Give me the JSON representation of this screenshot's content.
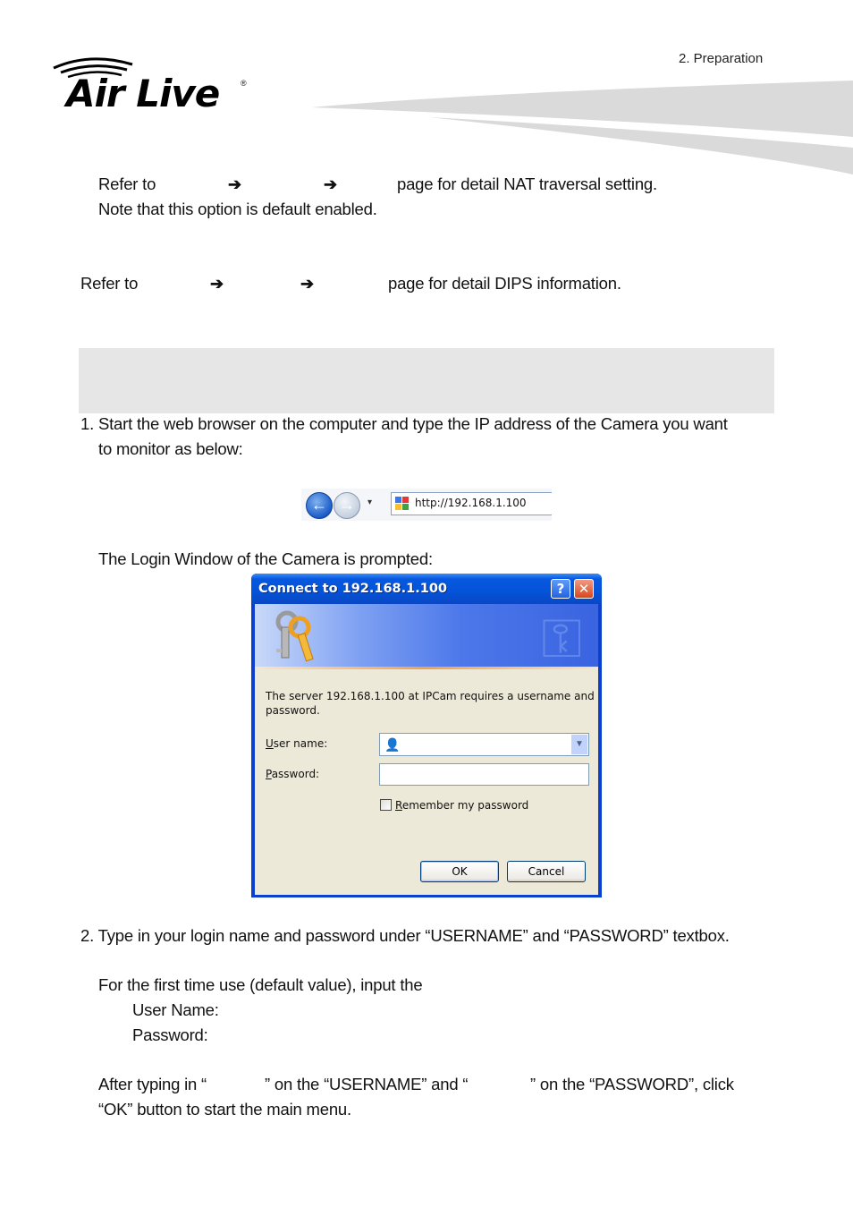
{
  "header": {
    "chapter": "2.  Preparation",
    "logo": {
      "brand": "Air Live",
      "registered": "®"
    }
  },
  "nat_section": {
    "line1_refer": "Refer to",
    "line1_arrow": "➔",
    "line1_tail": "page for detail NAT traversal setting.",
    "line2": "Note that this option is default enabled."
  },
  "dips_section": {
    "refer": "Refer to",
    "arrow": "➔",
    "tail": "page for detail DIPS information."
  },
  "steps": {
    "step1_line1": "1. Start the web browser on the computer and type the IP address of the Camera you want",
    "step1_line2": "to monitor as below:",
    "browser": {
      "back_icon": "back-arrow-icon",
      "forward_icon": "forward-arrow-icon",
      "dropdown_icon": "▾",
      "url": "http://192.168.1.100"
    },
    "login_prompt": "The Login Window of the Camera is prompted:",
    "step2": "2. Type in your login name and password under “USERNAME” and “PASSWORD” textbox.",
    "first_time": "For the first time use (default value), input the",
    "user_name_label": "User Name:",
    "password_label": "Password:",
    "after_typing_1": "After typing in “",
    "after_typing_2": "” on the “USERNAME” and “",
    "after_typing_3": "” on the “PASSWORD”, click",
    "after_typing_line2": "“OK” button to start the main menu."
  },
  "dialog": {
    "title": "Connect to 192.168.1.100",
    "help_label": "?",
    "close_label": "✕",
    "message_line1": "The server 192.168.1.100 at IPCam requires a username and",
    "message_line2": "password.",
    "username_label_u": "U",
    "username_label_rest": "ser name:",
    "username_value": "",
    "password_label_u": "P",
    "password_label_rest": "assword:",
    "password_value": "",
    "remember_u": "R",
    "remember_rest": "emember my password",
    "remember_checked": false,
    "ok_label": "OK",
    "cancel_label": "Cancel"
  }
}
